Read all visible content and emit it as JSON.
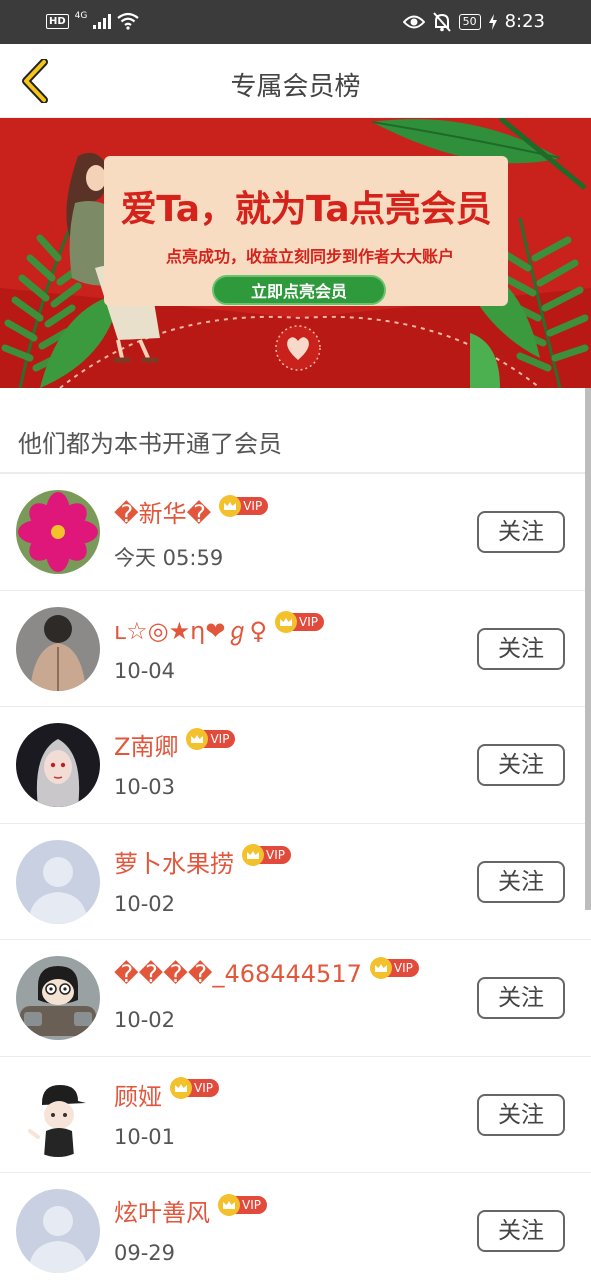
{
  "status_bar": {
    "hd": "HD",
    "network": "4G",
    "battery": "50",
    "time": "8:23"
  },
  "header": {
    "title": "专属会员榜"
  },
  "banner": {
    "title": "爱Ta，就为Ta点亮会员",
    "subtitle": "点亮成功，收益立刻同步到作者大大账户",
    "cta": "立即点亮会员"
  },
  "section": {
    "title": "他们都为本书开通了会员"
  },
  "members": [
    {
      "name": "�新华�",
      "date": "今天 05:59",
      "vip": "VIP",
      "follow": "关注",
      "avatar": "pink-flower"
    },
    {
      "name": "ʟ☆◎★η❤ℊ♀",
      "date": "10-04",
      "vip": "VIP",
      "follow": "关注",
      "avatar": "photo-person"
    },
    {
      "name": "Z南卿",
      "date": "10-03",
      "vip": "VIP",
      "follow": "关注",
      "avatar": "anime-girl"
    },
    {
      "name": "萝卜水果捞",
      "date": "10-02",
      "vip": "VIP",
      "follow": "关注",
      "avatar": "default"
    },
    {
      "name": "����_468444517",
      "date": "10-02",
      "vip": "VIP",
      "follow": "关注",
      "avatar": "cartoon-boy"
    },
    {
      "name": "顾娅",
      "date": "10-01",
      "vip": "VIP",
      "follow": "关注",
      "avatar": "chibi-cap"
    },
    {
      "name": "炫叶善风",
      "date": "09-29",
      "vip": "VIP",
      "follow": "关注",
      "avatar": "default"
    }
  ],
  "colors": {
    "banner_red": "#c9211c",
    "name_red": "#e2573c",
    "vip_gold": "#f2c12c",
    "cta_green": "#2e9a3b"
  }
}
